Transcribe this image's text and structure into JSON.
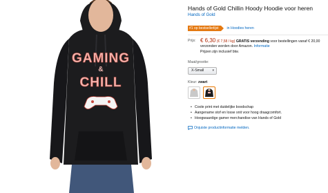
{
  "product": {
    "title": "Hands of Gold Chillin Hoody Hoodie voor heren",
    "brand": "Hands of Gold",
    "image_print_line1": "GAMING",
    "image_print_amp": "&",
    "image_print_line2": "CHILL"
  },
  "badge": {
    "label": "#1 op bestsellerlijst",
    "category": "in Hoodies heren",
    "color": "#e47911"
  },
  "price": {
    "label": "Prijs:",
    "amount": "€ 6,30",
    "unit_price": "(€ 7,58 / kg)",
    "shipping_bold": "GRATIS verzending",
    "shipping_rest": "voor bestellingen vanaf € 20,00",
    "shipping_line2": "verzonden worden door Amazon.",
    "info_link": "Informatie",
    "vat_note": "Prijzen zijn inclusief btw."
  },
  "size": {
    "label": "Maat/grootte:",
    "selected": "X-Small"
  },
  "color": {
    "label": "Kleur:",
    "selected": "zwart",
    "swatches": [
      "grijs",
      "zwart"
    ]
  },
  "features": [
    "Coole print met duidelijke boodschap",
    "Aangename stof en losse snit voor hoog draagcomfort.",
    "Hoogwaardige gamer merchandise van Hands of Gold"
  ],
  "report_link": "Onjuiste productinformatie melden.",
  "colors": {
    "link": "#0066c0",
    "price": "#b12704",
    "hoodie": "#1c1c1e",
    "print": "#f2b8b3"
  }
}
